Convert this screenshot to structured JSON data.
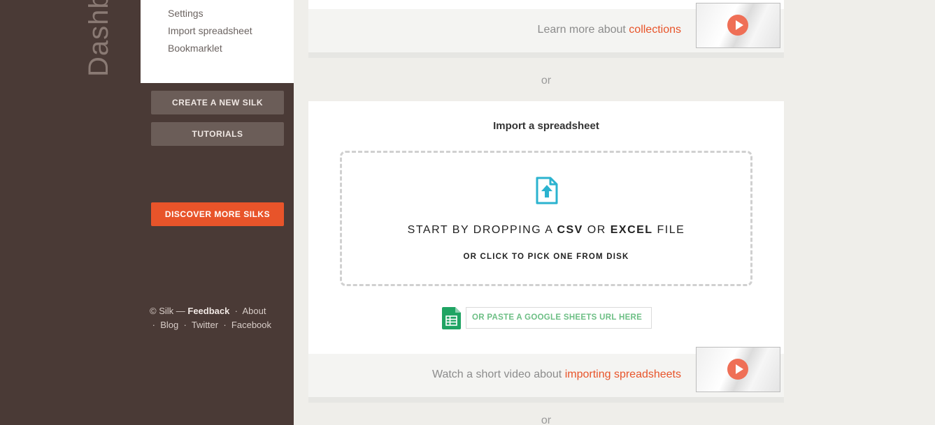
{
  "sidebar": {
    "vertical_title": "Dashboard",
    "menu": [
      "Settings",
      "Import spreadsheet",
      "Bookmarklet"
    ],
    "create_label": "CREATE A NEW SILK",
    "tutorials_label": "TUTORIALS",
    "discover_label": "DISCOVER MORE SILKS"
  },
  "footer": {
    "copyright": "© Silk —",
    "feedback": "Feedback",
    "about": "About",
    "blog": "Blog",
    "twitter": "Twitter",
    "facebook": "Facebook",
    "separator": "·"
  },
  "collections_bar": {
    "text": "Learn more about ",
    "link": "collections"
  },
  "or_label": "or",
  "import": {
    "title": "Import a spreadsheet",
    "drop_prefix": "START BY DROPPING A ",
    "csv": "CSV",
    "or_word": " OR ",
    "excel": "EXCEL",
    "file_word": " FILE",
    "drop_sub": "OR CLICK TO PICK ONE FROM DISK",
    "sheets_placeholder": "OR PASTE A GOOGLE SHEETS URL HERE"
  },
  "video_bar": {
    "text": "Watch a short video about ",
    "link": "importing spreadsheets"
  },
  "colors": {
    "accent": "#e8542a",
    "sidebar": "#4a3a36",
    "upload_icon": "#2bb3cf",
    "sheets_green": "#1fa463"
  }
}
